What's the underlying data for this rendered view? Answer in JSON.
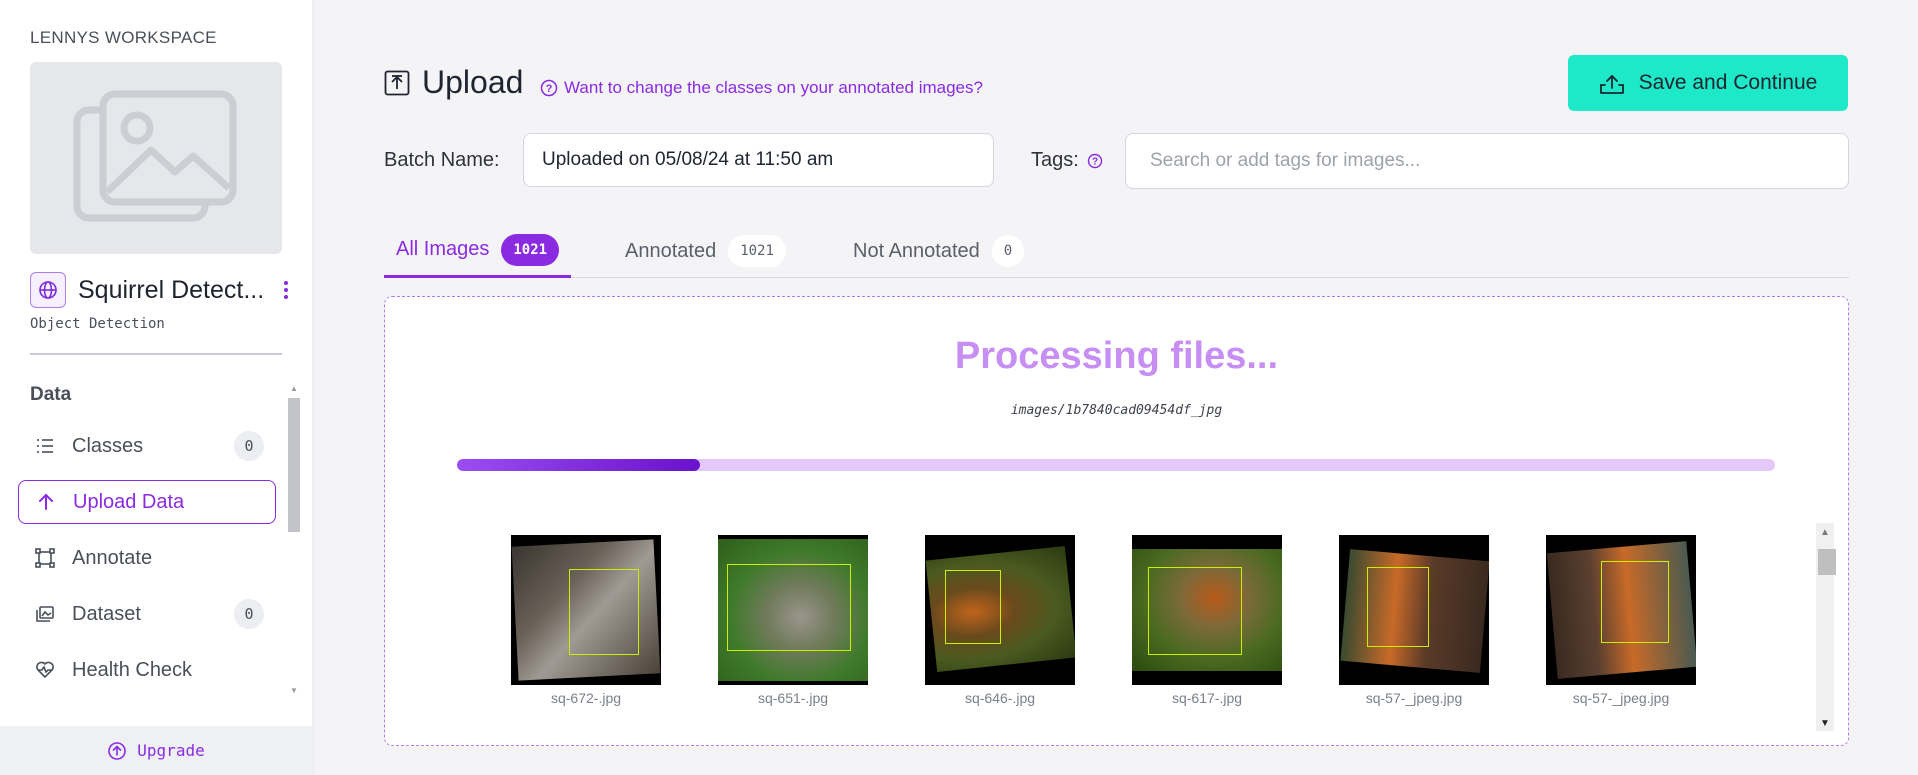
{
  "sidebar": {
    "workspace": "LENNYS WORKSPACE",
    "project_name": "Squirrel Detect...",
    "project_type": "Object Detection",
    "section": "Data",
    "items": [
      {
        "label": "Classes",
        "count": "0"
      },
      {
        "label": "Upload Data"
      },
      {
        "label": "Annotate"
      },
      {
        "label": "Dataset",
        "count": "0"
      },
      {
        "label": "Health Check"
      }
    ],
    "upgrade": "Upgrade"
  },
  "header": {
    "title": "Upload",
    "help_link": "Want to change the classes on your annotated images?",
    "save_button": "Save and Continue"
  },
  "form": {
    "batch_label": "Batch Name:",
    "batch_value": "Uploaded on 05/08/24 at 11:50 am",
    "tags_label": "Tags:",
    "tags_placeholder": "Search or add tags for images..."
  },
  "tabs": [
    {
      "label": "All Images",
      "count": "1021"
    },
    {
      "label": "Annotated",
      "count": "1021"
    },
    {
      "label": "Not Annotated",
      "count": "0"
    }
  ],
  "processing": {
    "title": "Processing files...",
    "file": "images/1b7840cad09454df_jpg",
    "progress": 0.184
  },
  "thumbnails": [
    {
      "caption": "sq-672-.jpg"
    },
    {
      "caption": "sq-651-.jpg"
    },
    {
      "caption": "sq-646-.jpg"
    },
    {
      "caption": "sq-617-.jpg"
    },
    {
      "caption": "sq-57-_jpeg.jpg"
    },
    {
      "caption": "sq-57-_jpeg.jpg"
    }
  ],
  "colors": {
    "accent": "#8a2be2",
    "save_button": "#1de9c8",
    "bbox": "#c8f000"
  },
  "icons": [
    "image-placeholder-icon",
    "globe-icon",
    "kebab-icon",
    "list-icon",
    "arrow-up-icon",
    "annotate-icon",
    "dataset-icon",
    "heart-pulse-icon",
    "upload-icon",
    "help-circle-icon",
    "cloud-upload-icon"
  ]
}
